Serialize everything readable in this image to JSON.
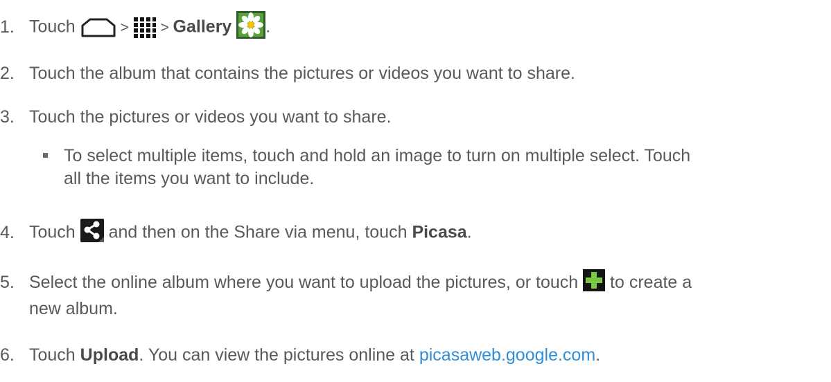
{
  "steps": [
    {
      "num": "1.",
      "t_before": "Touch ",
      "sep1": " > ",
      "sep2": " > ",
      "bold": "Gallery",
      "t_after": "."
    },
    {
      "num": "2.",
      "text": "Touch the album that contains the pictures or videos you want to share."
    },
    {
      "num": "3.",
      "text": "Touch the pictures or videos you want to share."
    },
    {
      "num": "4.",
      "t_before": "Touch ",
      "t_mid": " and then on the Share via menu, touch ",
      "bold": "Picasa",
      "t_after": "."
    },
    {
      "num": "5.",
      "t_before": "Select the online album where you want to upload the pictures, or touch ",
      "t_after": " to create a",
      "line2": "new album."
    },
    {
      "num": "6.",
      "t_before": "Touch ",
      "bold": "Upload",
      "t_mid": ". You can view the pictures online at ",
      "link": "picasaweb.google.com",
      "t_after": "."
    }
  ],
  "bullet": {
    "line1": "To select multiple items, touch and hold an image to turn on multiple select. Touch",
    "line2": "all the items you want to include."
  },
  "icons": {
    "home": "home-icon",
    "apps": "apps-icon",
    "gallery": "gallery-icon",
    "share": "share-icon",
    "plus": "plus-icon"
  },
  "colors": {
    "text": "#595959",
    "link": "#2e8fd6",
    "plus_green": "#7ac943"
  }
}
